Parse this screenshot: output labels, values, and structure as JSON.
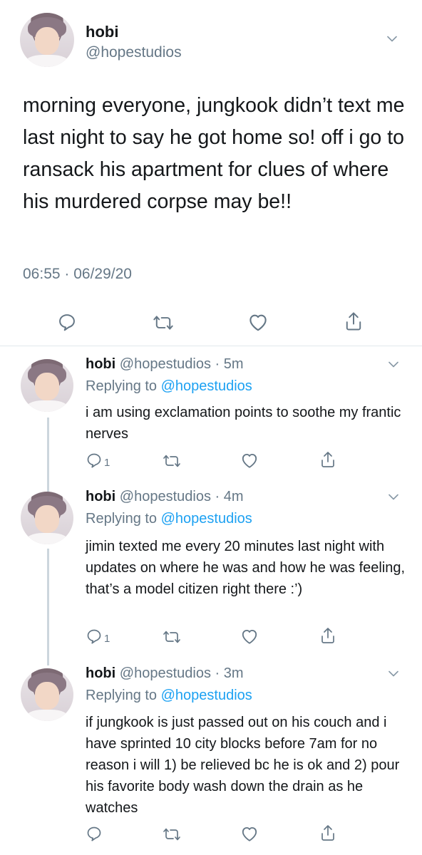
{
  "main_tweet": {
    "name": "hobi",
    "handle": "@hopestudios",
    "text": "morning everyone, jungkook didn’t text me last night to say he got home so! off i go to ransack his apartment for clues of where his murdered corpse may be!!",
    "meta": "06:55 · 06/29/20"
  },
  "replies": [
    {
      "name": "hobi",
      "handle_time": "@hopestudios · 5m",
      "replying_prefix": "Replying to",
      "replying_to": "@hopestudios",
      "text": "i am using exclamation points to soothe my frantic nerves",
      "reply_count": "1"
    },
    {
      "name": "hobi",
      "handle_time": "@hopestudios · 4m",
      "replying_prefix": "Replying to",
      "replying_to": "@hopestudios",
      "text": "jimin texted me every 20 minutes last night with updates on where he was and how he was feeling, that’s a model citizen right there :’)",
      "reply_count": "1"
    },
    {
      "name": "hobi",
      "handle_time": "@hopestudios · 3m",
      "replying_prefix": "Replying to",
      "replying_to": "@hopestudios",
      "text": "if jungkook is just passed out on his couch and i have sprinted 10 city blocks before 7am for no reason i will 1) be relieved bc he is ok and 2) pour his favorite body wash down the drain as he watches",
      "reply_count": ""
    }
  ],
  "icons": {
    "reply": "reply-icon",
    "retweet": "retweet-icon",
    "like": "heart-icon",
    "share": "share-icon",
    "more": "chevron-down-icon",
    "avatar": "profile-avatar"
  },
  "colors": {
    "text": "#14171a",
    "secondary": "#657786",
    "link": "#1da1f2",
    "divider": "#e1e8ed"
  }
}
